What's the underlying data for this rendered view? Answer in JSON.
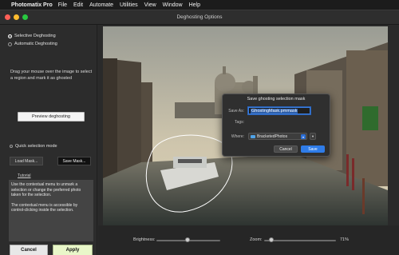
{
  "menubar": {
    "app_name": "Photomatix Pro",
    "items": [
      "File",
      "Edit",
      "Automate",
      "Utilities",
      "View",
      "Window",
      "Help"
    ]
  },
  "window": {
    "title": "Deghosting Options",
    "traffic_colors": [
      "#fe5f57",
      "#febc2e",
      "#28c840"
    ]
  },
  "left": {
    "mode_options": [
      "Selective Deghosting",
      "Automatic Deghosting"
    ],
    "instructions": "Drag your mouse over the image to select a region and mark it as ghosted",
    "preview_button": "Preview deghosting",
    "quick_selection": "Quick selection mode",
    "load_mask": "Load Mask...",
    "save_mask": "Save Mask...",
    "tutorial_link": "Tutorial",
    "tutorial_text_1": "Use the contextual menu to unmark a selection or change the preferred photo taken for the selection.",
    "tutorial_text_2": "The contextual menu is accessible by control-clicking inside the selection.",
    "cancel": "Cancel",
    "apply": "Apply"
  },
  "bottom": {
    "brightness_label": "Brightness:",
    "brightness_level": 0.55,
    "zoom_label": "Zoom:",
    "zoom_value": "71%",
    "zoom_level": 0.71
  },
  "dialog": {
    "title": "Save ghosting selection mask",
    "save_as_label": "Save As:",
    "save_as_value": "GhostingMask.pmmask",
    "tags_label": "Tags:",
    "where_label": "Where:",
    "where_value": "BracketedPhotos",
    "cancel": "Cancel",
    "save": "Save"
  },
  "colors": {
    "accent": "#2f7ce8",
    "apply_bg": "#e9f7c9"
  }
}
